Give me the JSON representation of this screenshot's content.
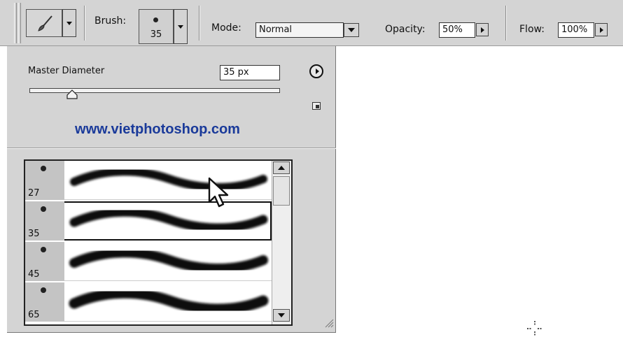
{
  "options_bar": {
    "tool_icon": "brush-tool-icon",
    "brush_label": "Brush:",
    "brush_size": "35",
    "mode_label": "Mode:",
    "mode_value": "Normal",
    "opacity_label": "Opacity:",
    "opacity_value": "50%",
    "flow_label": "Flow:",
    "flow_value": "100%"
  },
  "brush_panel": {
    "master_diameter_label": "Master Diameter",
    "master_diameter_value": "35 px",
    "master_diameter_fraction": 0.17,
    "watermark": "www.vietphotoshop.com",
    "brushes": [
      {
        "size": "27"
      },
      {
        "size": "35",
        "selected": true
      },
      {
        "size": "45"
      },
      {
        "size": "65"
      }
    ]
  },
  "colors": {
    "ui_gray": "#d4d4d4",
    "watermark_blue": "#1a3a9a"
  }
}
